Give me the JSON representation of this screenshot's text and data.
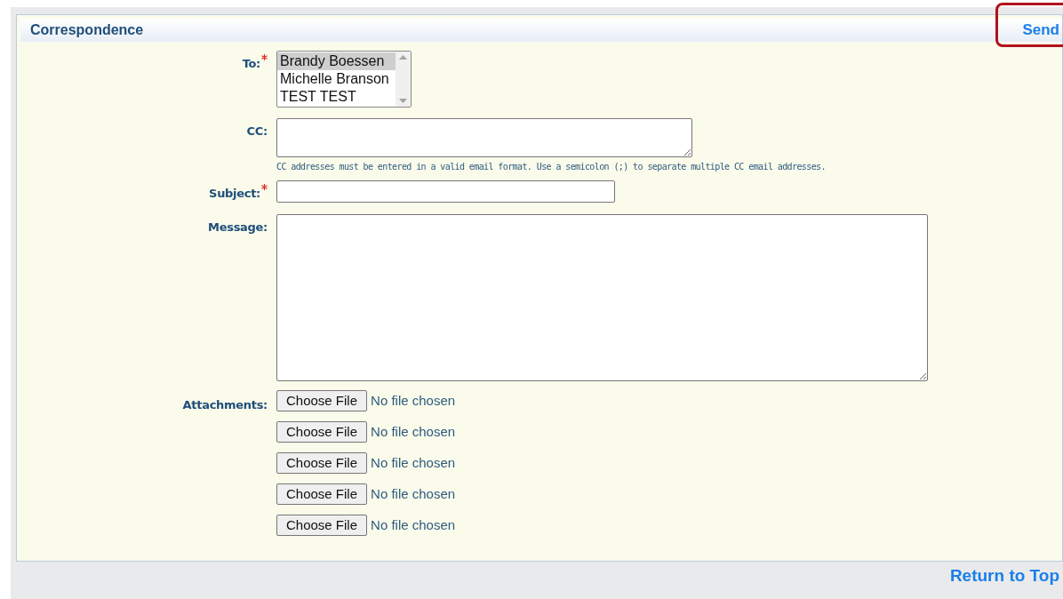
{
  "panel": {
    "title": "Correspondence",
    "send_link": {
      "label": "Send",
      "highlighted": true
    }
  },
  "fields": [
    {
      "kind": "listbox",
      "label": "To:",
      "required": true,
      "options": [
        {
          "label": "Brandy Boessen",
          "selected": true
        },
        {
          "label": "Michelle Branson",
          "selected": false
        },
        {
          "label": "TEST TEST",
          "selected": false
        }
      ]
    },
    {
      "kind": "short_textarea",
      "label": "CC:",
      "required": false,
      "hint": "CC addresses must be entered in a valid email format. Use a semicolon (;) to separate multiple CC email addresses."
    },
    {
      "kind": "input",
      "label": "Subject:",
      "required": true
    },
    {
      "kind": "textarea",
      "label": "Message:",
      "required": false
    },
    {
      "kind": "files",
      "label": "Attachments:",
      "required": false,
      "files": [
        {
          "button": "Choose File",
          "status": "No file chosen"
        },
        {
          "button": "Choose File",
          "status": "No file chosen"
        },
        {
          "button": "Choose File",
          "status": "No file chosen"
        },
        {
          "button": "Choose File",
          "status": "No file chosen"
        },
        {
          "button": "Choose File",
          "status": "No file chosen"
        }
      ]
    }
  ],
  "return_link": "Return to Top"
}
